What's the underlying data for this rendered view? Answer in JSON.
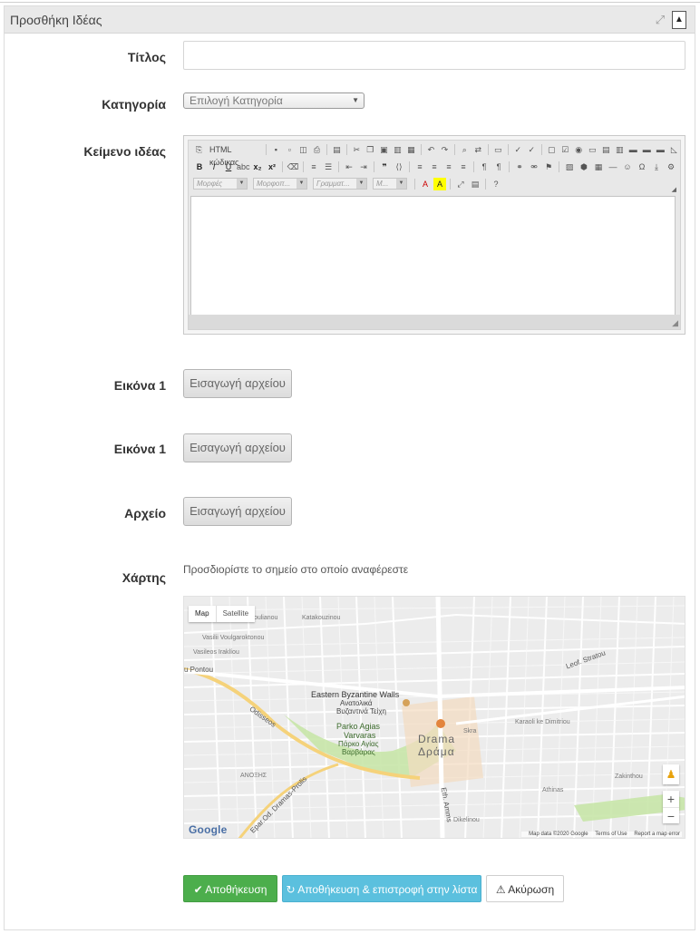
{
  "panel": {
    "title": "Προσθήκη Ιδέας",
    "expand_icon": "expand-icon",
    "collapse_icon": "caret-up-icon"
  },
  "form": {
    "title_label": "Τίτλος",
    "title_value": "",
    "category_label": "Κατηγορία",
    "category_selected": "Επιλογή Κατηγορία",
    "text_label": "Κείμενο ιδέας",
    "image1_label": "Εικόνα 1",
    "image2_label": "Εικόνα 1",
    "file_label": "Αρχείο",
    "upload_button": "Εισαγωγή αρχείου",
    "map_label": "Χάρτης",
    "map_hint": "Προσδιορίστε το σημείο στο οποίο αναφέρεστε"
  },
  "editor": {
    "source_label": "HTML κώδικας",
    "combos": [
      "Μορφές",
      "Μορφοπ...",
      "Γραμματ...",
      "Μ..."
    ]
  },
  "map": {
    "map_button": "Map",
    "satellite_button": "Satellite",
    "google": "Google",
    "map_data": "Map data ©2020 Google",
    "terms": "Terms of Use",
    "report": "Report a map error",
    "labels": {
      "byzantine": "Eastern Byzantine Walls",
      "byzantine_gr1": "Ανατολικά",
      "byzantine_gr2": "Βυζαντινά Τείχη",
      "park": "Parko Agias",
      "park2": "Varvaras",
      "park_gr1": "Πάρκο Αγίας",
      "park_gr2": "Βαρβάρας",
      "drama": "Drama",
      "drama_gr": "Δράμα",
      "pontou": "u Pontou",
      "odisseos": "Odisseos",
      "prolis": "Epar.Od. Dramas-Prolis",
      "ammis": "Eth. Amms",
      "leof": "Leof. Stratou",
      "vas": "Vasileos Iraklíou",
      "ioulianou": "Ioulianou",
      "katakouzinou": "Katakouzinou",
      "voulgaroktonou": "Vasilii Voulgaroktonou",
      "anoixis": "ΑΝΟΞΗΣ",
      "skra": "Skra",
      "karaoli": "Karaoli ke Dimitriou",
      "athinas": "Athinas",
      "zakinthou": "Zakinthou",
      "dikelinou": "Dikelinou",
      "terms_short": "Terms of Use"
    }
  },
  "actions": {
    "save": "✔ Αποθήκευση",
    "save_return": "↻ Αποθήκευση & επιστροφή στην λίστα",
    "cancel": "⚠ Ακύρωση"
  }
}
